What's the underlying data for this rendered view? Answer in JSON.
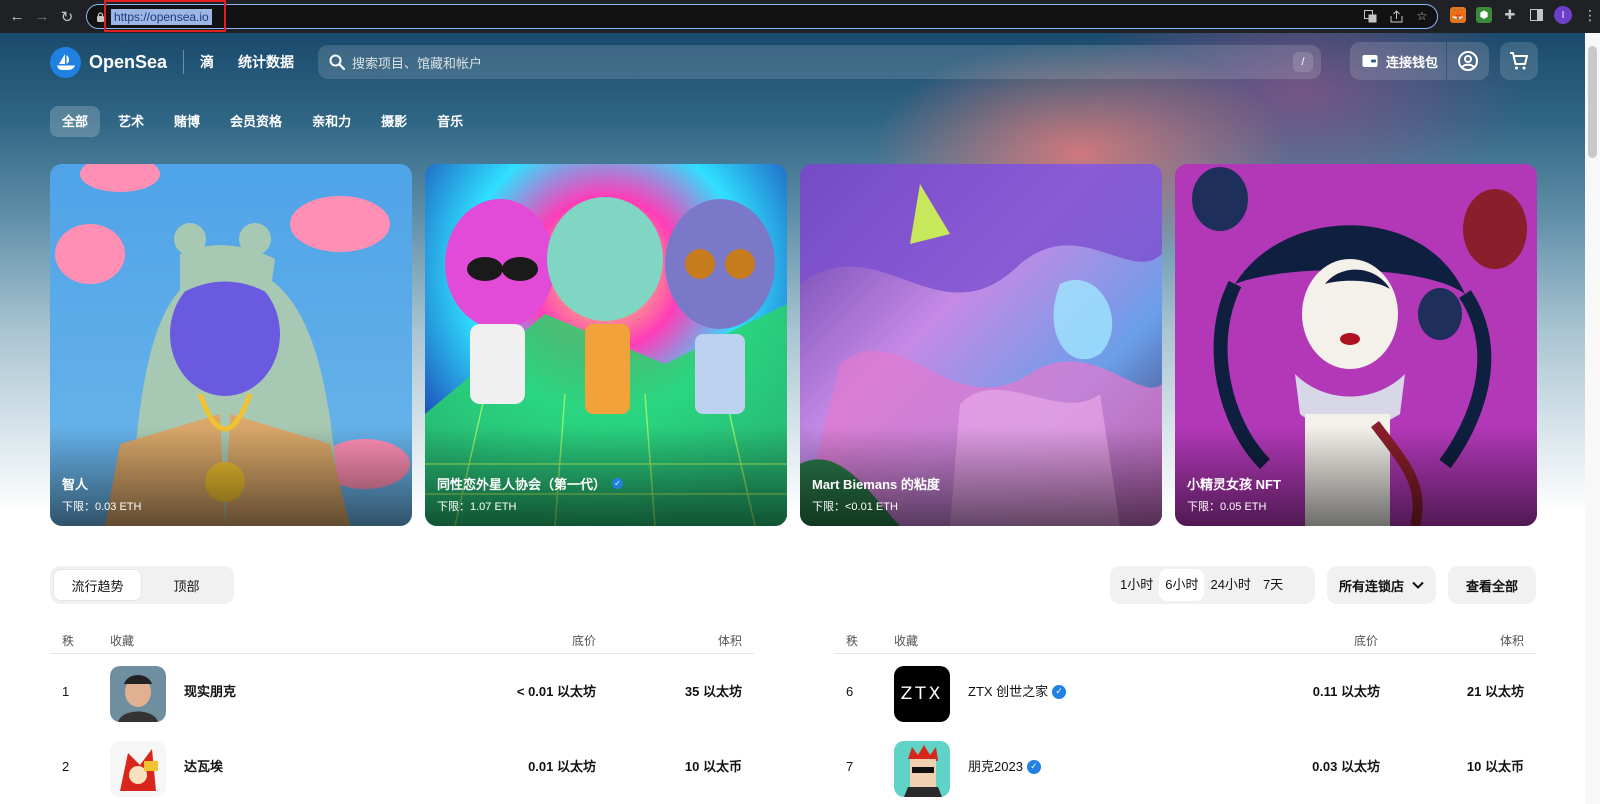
{
  "browser": {
    "url": "https://opensea.io"
  },
  "header": {
    "brand": "OpenSea",
    "links": [
      "滴",
      "统计数据"
    ],
    "search_placeholder": "搜索项目、馆藏和帐户",
    "search_shortcut": "/",
    "wallet_label": "连接钱包"
  },
  "categories": [
    "全部",
    "艺术",
    "赌博",
    "会员资格",
    "亲和力",
    "摄影",
    "音乐"
  ],
  "featured": [
    {
      "name": "智人",
      "floor": "下限：0.03 ETH",
      "verified": false
    },
    {
      "name": "同性恋外星人协会（第一代）",
      "floor": "下限：1.07 ETH",
      "verified": true
    },
    {
      "name": "Mart Biemans 的粘度",
      "floor": "下限：<0.01 ETH",
      "verified": false
    },
    {
      "name": "小精灵女孩 NFT",
      "floor": "下限：0.05 ETH",
      "verified": false
    }
  ],
  "rank_tabs": [
    "流行趋势",
    "顶部"
  ],
  "time_ranges": [
    "1小时",
    "6小时",
    "24小时",
    "7天"
  ],
  "chain_filter": "所有连锁店",
  "view_all": "查看全部",
  "table_headers": {
    "rank": "秩",
    "collection": "收藏",
    "floor": "底价",
    "volume": "体积"
  },
  "left_rows": [
    {
      "rank": "1",
      "name": "现实朋克",
      "floor": "< 0.01 以太坊",
      "volume": "35 以太坊",
      "verified": false
    },
    {
      "rank": "2",
      "name": "达瓦埃",
      "floor": "0.01 以太坊",
      "volume": "10 以太币",
      "verified": false
    }
  ],
  "right_rows": [
    {
      "rank": "6",
      "name": "ZTX 创世之家",
      "floor": "0.11 以太坊",
      "volume": "21 以太坊",
      "verified": true,
      "thumb_text": "ZTX"
    },
    {
      "rank": "7",
      "name": "朋克2023",
      "floor": "0.03 以太坊",
      "volume": "10 以太币",
      "verified": true
    }
  ],
  "colors": {
    "brand": "#2081e2",
    "highlight": "#e02020"
  }
}
